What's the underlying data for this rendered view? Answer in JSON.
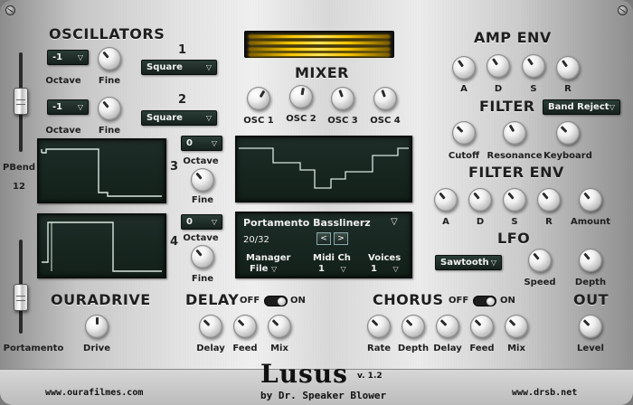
{
  "oscillators": {
    "title": "OSCILLATORS",
    "osc1": {
      "number": "1",
      "octave": "-1",
      "waveform": "Square"
    },
    "osc2": {
      "number": "2",
      "octave": "-1",
      "waveform": "Square"
    },
    "osc3": {
      "number": "3",
      "octave": "0"
    },
    "osc4": {
      "number": "4",
      "octave": "0"
    },
    "octave_label": "Octave",
    "fine_label": "Fine"
  },
  "pitch": {
    "pbend_label": "PBend",
    "pbend_value": "12",
    "portamento_label": "Portamento"
  },
  "mixer": {
    "title": "MIXER",
    "channels": [
      "OSC 1",
      "OSC 2",
      "OSC 3",
      "OSC 4"
    ]
  },
  "preset": {
    "name": "Portamento Basslinerz",
    "counter": "20/32",
    "prev": "<",
    "next": ">",
    "manager_label": "Manager",
    "manager_value": "File",
    "midi_label": "Midi Ch",
    "midi_value": "1",
    "voices_label": "Voices",
    "voices_value": "1"
  },
  "amp_env": {
    "title": "AMP ENV",
    "knobs": [
      "A",
      "D",
      "S",
      "R"
    ]
  },
  "filter": {
    "title": "FILTER",
    "type": "Band Reject",
    "knobs": [
      "Cutoff",
      "Resonance",
      "Keyboard"
    ]
  },
  "filter_env": {
    "title": "FILTER ENV",
    "knobs": [
      "A",
      "D",
      "S",
      "R",
      "Amount"
    ]
  },
  "lfo": {
    "title": "LFO",
    "waveform": "Sawtooth",
    "knobs": [
      "Speed",
      "Depth"
    ]
  },
  "ouradrive": {
    "title": "OURADRIVE",
    "knob": "Drive"
  },
  "delay": {
    "title": "DELAY",
    "off": "OFF",
    "on": "ON",
    "knobs": [
      "Delay",
      "Feed",
      "Mix"
    ]
  },
  "chorus": {
    "title": "CHORUS",
    "off": "OFF",
    "on": "ON",
    "knobs": [
      "Rate",
      "Depth",
      "Delay",
      "Feed",
      "Mix"
    ]
  },
  "out": {
    "title": "OUT",
    "knob": "Level"
  },
  "footer": {
    "logo": "Lusus",
    "version": "v. 1.2",
    "author": "by Dr. Speaker Blower",
    "url_left": "www.ourafilmes.com",
    "url_right": "www.drsb.net"
  },
  "colors": {
    "screen": "#1a2822",
    "trace": "#d9e6df",
    "vu": "#f7c400"
  }
}
